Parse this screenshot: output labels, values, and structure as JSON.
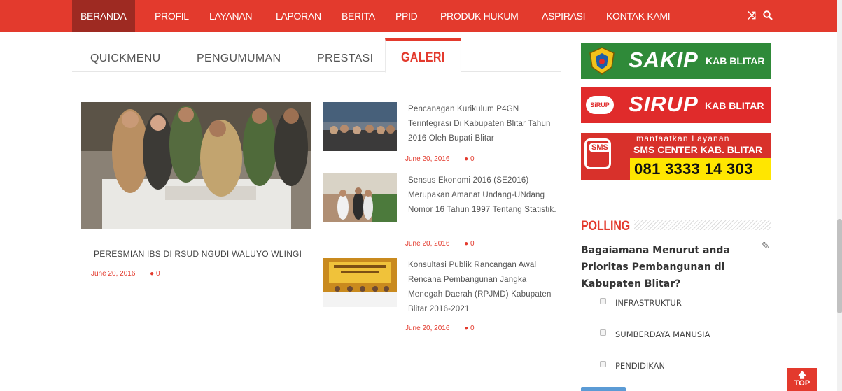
{
  "colors": {
    "accent": "#e33a2d",
    "nav_active": "#9e2a22",
    "sakip_bg": "#2f8a39",
    "sirup_bg": "#e02b2b",
    "sms_yellow": "#ffe600"
  },
  "nav": {
    "items": [
      "BERANDA",
      "PROFIL",
      "LAYANAN",
      "LAPORAN",
      "BERITA",
      "PPID",
      "PRODUK HUKUM",
      "ASPIRASI",
      "KONTAK KAMI"
    ],
    "active_index": 0,
    "icons": [
      "shuffle-icon",
      "search-icon"
    ]
  },
  "tabs": [
    "QUICKMENU",
    "PENGUMUMAN",
    "PRESTASI",
    "GALERI"
  ],
  "active_tab": "GALERI",
  "featured": {
    "title": "PERESMIAN IBS DI RSUD NGUDI WALUYO WLINGI",
    "date": "June 20, 2016",
    "comments": "0"
  },
  "articles": [
    {
      "title": "Pencanagan Kurikulum P4GN Terintegrasi Di Kabupaten Blitar Tahun 2016 Oleh Bupati Blitar",
      "date": "June 20, 2016",
      "comments": "0"
    },
    {
      "title": "Sensus Ekonomi 2016 (SE2016) Merupakan Amanat Undang-UNdang Nomor 16 Tahun 1997 Tentang Statistik.",
      "date": "June 20, 2016",
      "comments": "0"
    },
    {
      "title": "Konsultasi Publik Rancangan Awal Rencana Pembangunan Jangka Menegah Daerah (RPJMD) Kabupaten Blitar 2016-2021",
      "date": "June 20, 2016",
      "comments": "0"
    }
  ],
  "banners": {
    "sakip": {
      "main": "SAKIP",
      "sub": "KAB BLITAR"
    },
    "sirup": {
      "logo": "SiRUP",
      "main": "SIRUP",
      "sub": "KAB BLITAR"
    },
    "sms": {
      "logo": "SMS",
      "line1": "manfaatkan Layanan",
      "line2": "SMS CENTER KAB. BLITAR",
      "phone": "081 3333 14 303"
    }
  },
  "polling": {
    "heading": "POLLING",
    "question": "Bagaiamana Menurut anda Prioritas Pembangunan di Kabupaten Blitar?",
    "options": [
      "INFRASTRUKTUR",
      "SUMBERDAYA MANUSIA",
      "PENDIDIKAN"
    ]
  },
  "to_top": "TOP"
}
